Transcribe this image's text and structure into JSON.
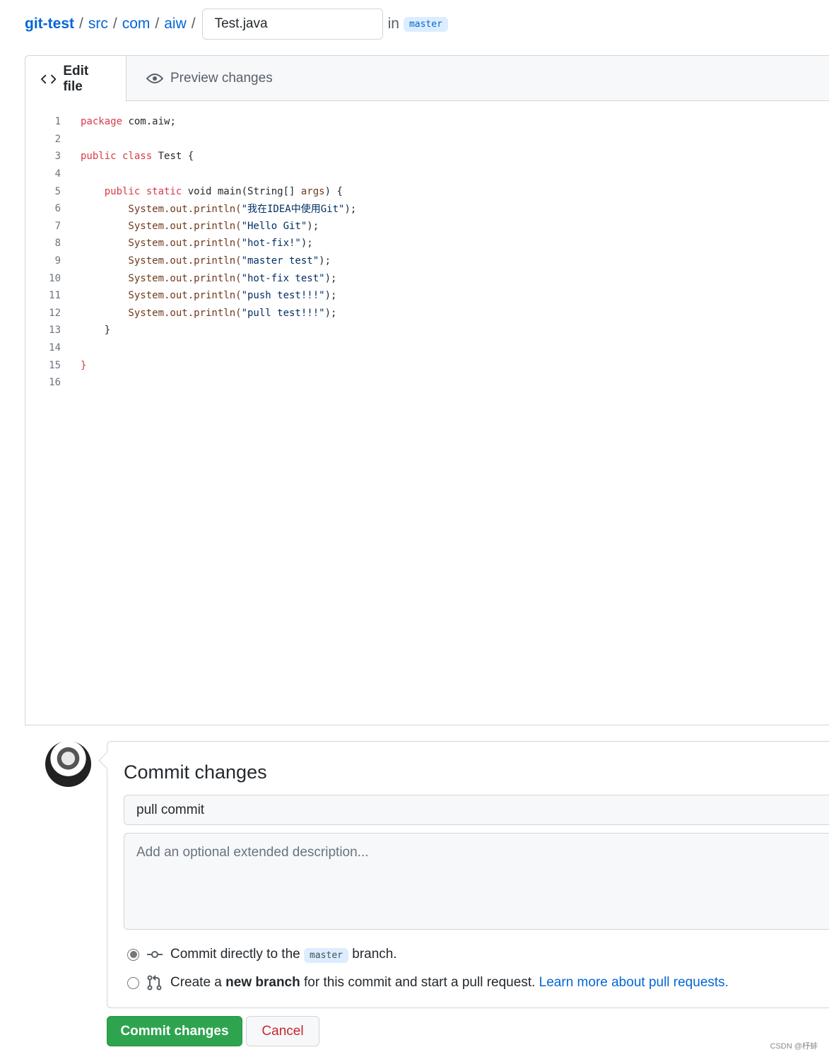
{
  "breadcrumb": {
    "repo": "git-test",
    "dirs": [
      "src",
      "com",
      "aiw"
    ],
    "filename": "Test.java",
    "in_label": "in",
    "branch": "master"
  },
  "tabs": [
    {
      "label": "Edit file",
      "icon": "code-icon",
      "active": true
    },
    {
      "label": "Preview changes",
      "icon": "eye-icon",
      "active": false
    }
  ],
  "code": [
    [
      [
        "package",
        "kw"
      ],
      [
        " com.aiw;",
        ""
      ]
    ],
    [],
    [
      [
        "public class",
        "kw"
      ],
      [
        " Test {",
        ""
      ]
    ],
    [],
    [
      [
        "    ",
        ""
      ],
      [
        "public static",
        "kw"
      ],
      [
        " void main(String[] ",
        ""
      ],
      [
        "args",
        "nm"
      ],
      [
        ") {",
        ""
      ]
    ],
    [
      [
        "        System.out.println(",
        "nm"
      ],
      [
        "\"我在IDEA中使用Git\"",
        "str"
      ],
      [
        ");",
        ""
      ]
    ],
    [
      [
        "        System.out.println(",
        "nm"
      ],
      [
        "\"Hello Git\"",
        "str"
      ],
      [
        ");",
        ""
      ]
    ],
    [
      [
        "        System.out.println(",
        "nm"
      ],
      [
        "\"hot-fix!\"",
        "str"
      ],
      [
        ");",
        ""
      ]
    ],
    [
      [
        "        System.out.println(",
        "nm"
      ],
      [
        "\"master test\"",
        "str"
      ],
      [
        ");",
        ""
      ]
    ],
    [
      [
        "        System.out.println(",
        "nm"
      ],
      [
        "\"hot-fix test\"",
        "str"
      ],
      [
        ");",
        ""
      ]
    ],
    [
      [
        "        System.out.println(",
        "nm"
      ],
      [
        "\"push test!!!\"",
        "str"
      ],
      [
        ");",
        ""
      ]
    ],
    [
      [
        "        System.out.println(",
        "nm"
      ],
      [
        "\"pull test!!!\"",
        "str"
      ],
      [
        ");",
        ""
      ]
    ],
    [
      [
        "    }",
        ""
      ]
    ],
    [],
    [
      [
        "}",
        "kw"
      ]
    ],
    []
  ],
  "commit": {
    "title": "Commit changes",
    "summary_value": "pull commit",
    "description_placeholder": "Add an optional extended description...",
    "option_direct": {
      "pre": "Commit directly to the",
      "branch": "master",
      "post": "branch.",
      "selected": true
    },
    "option_branch": {
      "pre": "Create a",
      "bold": "new branch",
      "post": "for this commit and start a pull request.",
      "link": "Learn more about pull requests.",
      "selected": false
    },
    "submit_label": "Commit changes",
    "cancel_label": "Cancel"
  },
  "watermark": "CSDN @杼蚌",
  "colors": {
    "link": "#0366d6",
    "primary": "#2ea44f",
    "danger": "#cb2431",
    "keyword": "#d73a49"
  }
}
